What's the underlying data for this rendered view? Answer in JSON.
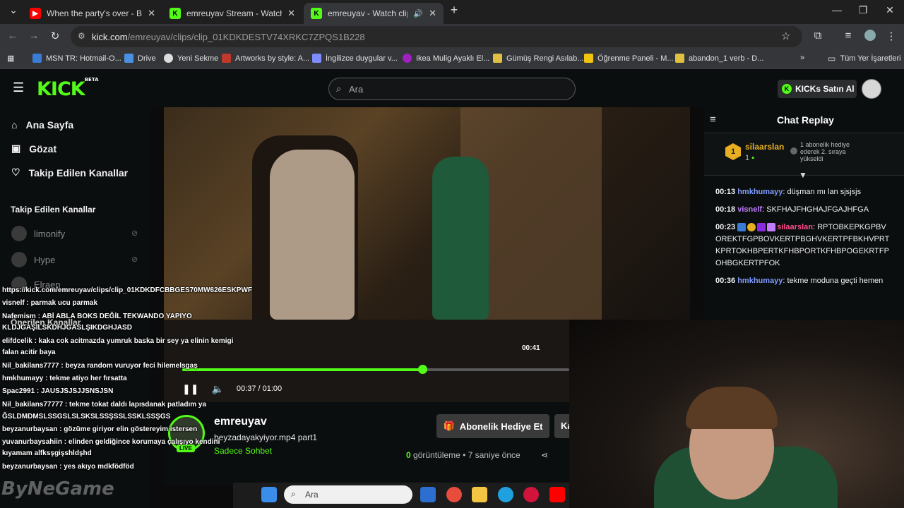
{
  "browser": {
    "tabs": [
      {
        "title": "When the party's over - Billie Eilish",
        "favicon": "youtube-icon"
      },
      {
        "title": "emreuyav Stream - Watch Live on Kick",
        "favicon": "kick-icon"
      },
      {
        "title": "emreuyav - Watch clips on Kick",
        "favicon": "kick-icon"
      }
    ],
    "new_tab": "+",
    "url_host": "kick.com",
    "url_path": "/emreuyav/clips/clip_01KDKDESTV74XRKC7ZPQS1B228",
    "bookmarks": [
      "MSN TR: Hotmail-O...",
      "Drive",
      "Yeni Sekme",
      "Artworks by style: A...",
      "İngilizce duygular v...",
      "Ikea Mulig Ayaklı El...",
      "Gümüş Rengi Asılab...",
      "Öğrenme Paneli - M...",
      "abandon_1 verb - D..."
    ],
    "bookmarks_more": "»",
    "all_bookmarks": "Tüm Yer İşaretleri"
  },
  "kick": {
    "logo": "KICK",
    "logo_beta": "BETA",
    "search_placeholder": "Ara",
    "kicks_button": "KICKs Satın Al",
    "nav": [
      "Ana Sayfa",
      "Gözat",
      "Takip Edilen Kanallar"
    ],
    "followed_title": "Takip Edilen Kanallar",
    "followed": [
      "limonify",
      "Hype",
      "Elraen"
    ],
    "recommended_title": "Önerilen Kanallar"
  },
  "player": {
    "hover_time": "00:41",
    "current_time": "00:37",
    "duration": "01:00",
    "progress": 0.62
  },
  "stream": {
    "streamer": "emreuyav",
    "live_badge": "LIVE",
    "clip_title": "beyzadayakyiyor.mp4 part1",
    "category": "Sadece Sohbet",
    "gift_button": "Abonelik Hediye Et",
    "sub_button": "Ka",
    "views_count": "0",
    "views_label": "görüntüleme",
    "time_ago": "7 saniye önce"
  },
  "chat": {
    "title": "Chat Replay",
    "pinned": {
      "badge": "1",
      "user": "silaarslan",
      "count": "1",
      "note": "1 abonelik hediye ederek 2. sıraya yükseldi"
    },
    "messages": [
      {
        "time": "00:13",
        "user": "hmkhumayy",
        "text": "düşman mı lan sjsjsjs"
      },
      {
        "time": "00:18",
        "user": "visnelf",
        "text": "SKFHAJFHGHAJFGAJHFGA"
      },
      {
        "time": "00:23",
        "user": "silaarslan",
        "text": "RPTOBKEPKGPBVOREKTFGPBOVKERTPBGHVKERTPFBKHVPRTKPRTOKHBPERTKFHBPORTKFHBPOGEKRTFPOHBGKERTPFOK"
      },
      {
        "time": "00:36",
        "user": "hmkhumayy",
        "text": "tekme moduna geçti hemen"
      }
    ]
  },
  "overlay_chat": [
    "https://kick.com/emreuyav/clips/clip_01KDKDFCBBGES70MW626ESKPWF",
    "visnelf : parmak ucu parmak",
    "Nafemism : ABİ ABLA BOKS DEĞİL TEKWANDO YAPIYO",
    "KLDJGAŞILSKDHJGASLŞIKDGHJASD",
    "elifdcelik : kaka cok acitmazda yumruk baska bir sey ya elinin kemigi",
    "falan acitir baya",
    "Nil_bakilans7777 : beyza random vuruyor feci hilemelsgaş",
    "hmkhumayy : tekme atiyo her fırsatta",
    "Spac2991 : JAUSJSJSJJSNSJSN",
    "Nil_bakilans77777 : tekme tokat daldı lapısdanak patladım ya",
    "ĞSLDMDMSLSSGSLSLSKSLSSŞSSLSSKLSSŞGS",
    "beyzanurbaysan : gözüme giriyor elin göstereyim istersen",
    "yuvanurbaysahiin : elinden geldiğince korumaya çalışıyo kendini",
    "kıyamam alfksşgişshldşhd",
    "beyzanurbaysan : yes akıyo mdkfödföd"
  ],
  "watermark": "ByNeGame",
  "taskbar": {
    "search_placeholder": "Ara"
  },
  "colors": {
    "kick_green": "#53fc18",
    "gold": "#e8b020",
    "bg": "#0b0e0f"
  }
}
